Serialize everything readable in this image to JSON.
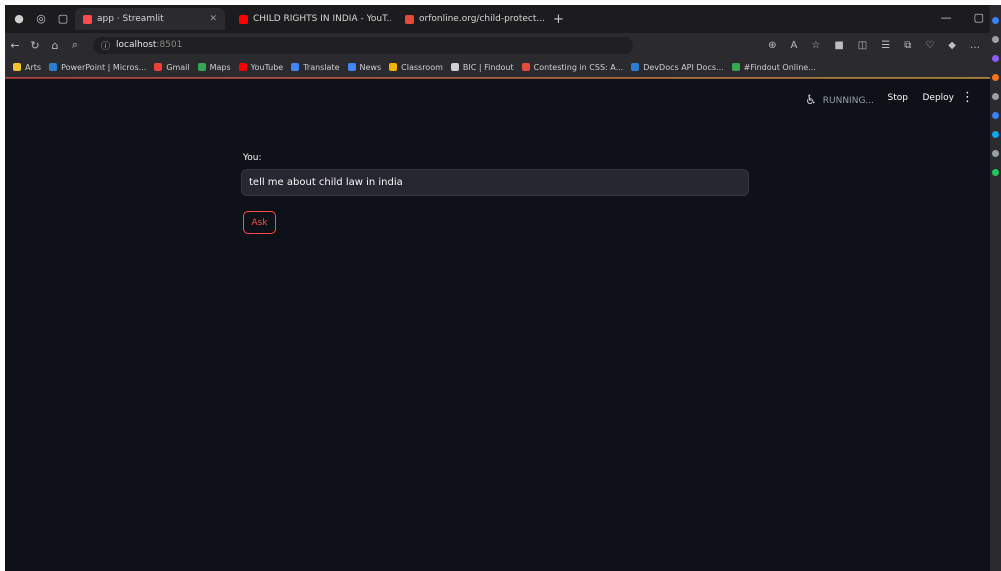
{
  "browser": {
    "tabs": [
      {
        "title": "app · Streamlit",
        "favicon_color": "#ff4b4b",
        "active": true
      },
      {
        "title": "CHILD RIGHTS IN INDIA - YouT...",
        "favicon_color": "#ff0000",
        "active": false
      },
      {
        "title": "orfonline.org/child-protect...",
        "favicon_color": "#e34b3b",
        "active": false
      }
    ],
    "new_tab": "+",
    "url_host": "localhost",
    "url_port": ":8501"
  },
  "bookmarks": [
    {
      "label": "Arts",
      "color": "#f4c430"
    },
    {
      "label": "PowerPoint | Micros...",
      "color": "#2b7cd3"
    },
    {
      "label": "Gmail",
      "color": "#ea4335"
    },
    {
      "label": "Maps",
      "color": "#34a853"
    },
    {
      "label": "YouTube",
      "color": "#ff0000"
    },
    {
      "label": "Translate",
      "color": "#4285f4"
    },
    {
      "label": "News",
      "color": "#4285f4"
    },
    {
      "label": "Classroom",
      "color": "#f4b400"
    },
    {
      "label": "BIC | Findout",
      "color": "#cfcfcf"
    },
    {
      "label": "Contesting in CSS: A...",
      "color": "#e34b3b"
    },
    {
      "label": "DevDocs API Docs...",
      "color": "#2b7cd3"
    },
    {
      "label": "#Findout Online...",
      "color": "#34a853"
    }
  ],
  "streamlit": {
    "status": "RUNNING...",
    "stop": "Stop",
    "deploy": "Deploy",
    "menu": "⋮"
  },
  "form": {
    "label": "You:",
    "value": "tell me about child law in india",
    "button": "Ask"
  },
  "colors": {
    "background": "#0e1117",
    "input_bg": "#262730",
    "accent": "#ff4b4b"
  }
}
